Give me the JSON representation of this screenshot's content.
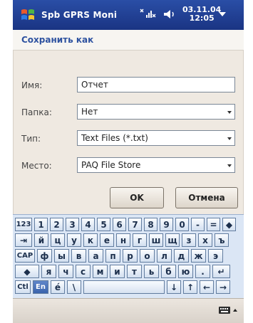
{
  "status_bar": {
    "app_title": "Spb GPRS Moni",
    "date": "03.11.04",
    "time": "12:05",
    "start_icon": "windows-flag-icon",
    "signal_icon": "signal-icon",
    "volume_icon": "volume-icon"
  },
  "header": {
    "title": "Сохранить как"
  },
  "form": {
    "name_label": "Имя:",
    "name_value": "Отчет",
    "folder_label": "Папка:",
    "folder_value": "Нет",
    "type_label": "Тип:",
    "type_value": "Text Files (*.txt)",
    "location_label": "Место:",
    "location_value": "PAQ File Store"
  },
  "buttons": {
    "ok": "OK",
    "cancel": "Отмена"
  },
  "keyboard": {
    "row1": [
      "123",
      "1",
      "2",
      "3",
      "4",
      "5",
      "6",
      "7",
      "8",
      "9",
      "0",
      "-",
      "=",
      "◆"
    ],
    "row2": [
      "⇥",
      "й",
      "ц",
      "у",
      "к",
      "е",
      "н",
      "г",
      "ш",
      "щ",
      "з",
      "х",
      "ъ"
    ],
    "row3": [
      "CAP",
      "ф",
      "ы",
      "в",
      "а",
      "п",
      "р",
      "о",
      "л",
      "д",
      "ж",
      "э"
    ],
    "row4": [
      "◆",
      "я",
      "ч",
      "с",
      "м",
      "и",
      "т",
      "ь",
      "б",
      "ю",
      ".",
      "↵"
    ],
    "row5": [
      "Ctl",
      "En",
      "é",
      "\\",
      "",
      "↓",
      "↑",
      "←",
      "→"
    ]
  },
  "colors": {
    "status_bar": "#1f3f96",
    "header_title": "#2e52a0",
    "keyboard_bg": "#dbe6f5",
    "key_blue": "#3f69b3"
  }
}
